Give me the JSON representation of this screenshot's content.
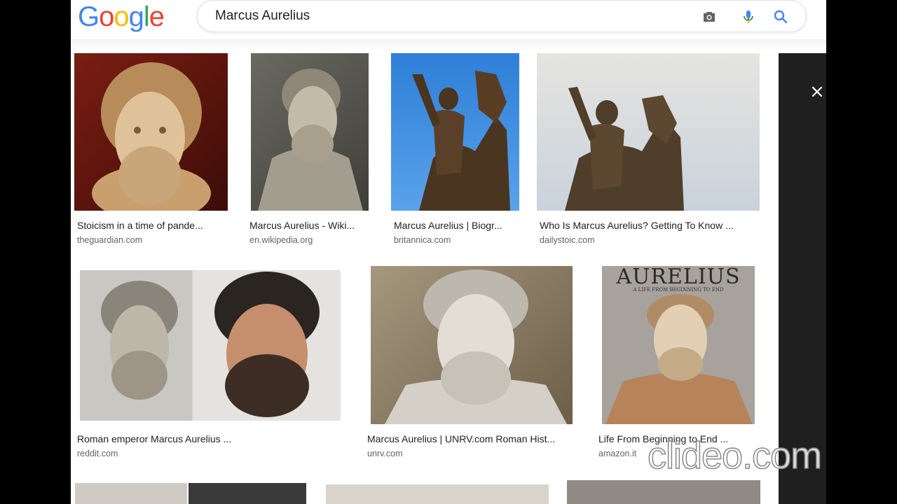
{
  "logo": {
    "letters": [
      "G",
      "o",
      "o",
      "g",
      "l",
      "e"
    ],
    "colors": [
      "#4285F4",
      "#EA4335",
      "#FBBC05",
      "#4285F4",
      "#34A853",
      "#EA4335"
    ]
  },
  "search": {
    "query": "Marcus Aurelius"
  },
  "icons": {
    "camera": "camera-icon",
    "mic": "mic-icon",
    "search": "search-icon",
    "close": "close-icon"
  },
  "results": [
    {
      "caption": "Stoicism in a time of pande...",
      "source": "theguardian.com"
    },
    {
      "caption": "Marcus Aurelius - Wiki...",
      "source": "en.wikipedia.org"
    },
    {
      "caption": "Marcus Aurelius | Biogr...",
      "source": "britannica.com"
    },
    {
      "caption": "Who Is Marcus Aurelius? Getting To Know ...",
      "source": "dailystoic.com"
    },
    {
      "caption": "Roman emperor Marcus Aurelius ...",
      "source": "reddit.com"
    },
    {
      "caption": "Marcus Aurelius | UNRV.com Roman Hist...",
      "source": "unrv.com"
    },
    {
      "caption": "Life From Beginning to End ...",
      "source": "amazon.it"
    }
  ],
  "book_cover_title": "AURELIUS",
  "book_cover_subtitle": "A LIFE FROM BEGINNING TO END",
  "watermark": "clideo.com"
}
